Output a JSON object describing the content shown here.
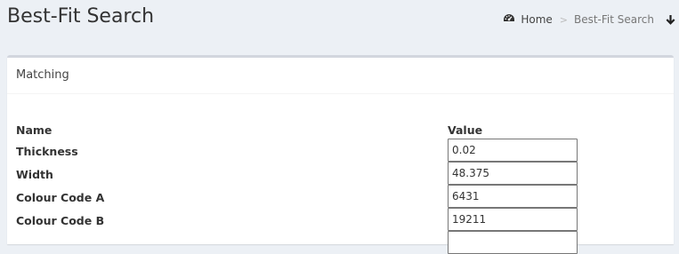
{
  "header": {
    "title": "Best-Fit Search",
    "breadcrumb": {
      "home_label": "Home",
      "home_icon": "dashboard-icon",
      "separator": ">",
      "current": "Best-Fit Search",
      "action_icon": "arrow-down-icon"
    }
  },
  "panel": {
    "title": "Matching",
    "columns": {
      "name": "Name",
      "value": "Value"
    },
    "rows": [
      {
        "name": "Thickness",
        "value": "0.02"
      },
      {
        "name": "Width",
        "value": "48.375"
      },
      {
        "name": "Colour Code A",
        "value": "6431"
      },
      {
        "name": "Colour Code B",
        "value": "19211"
      },
      {
        "name": "",
        "value": ""
      }
    ]
  },
  "colors": {
    "background": "#ecf0f5",
    "panel_border": "#d2d6de",
    "text": "#333333"
  }
}
